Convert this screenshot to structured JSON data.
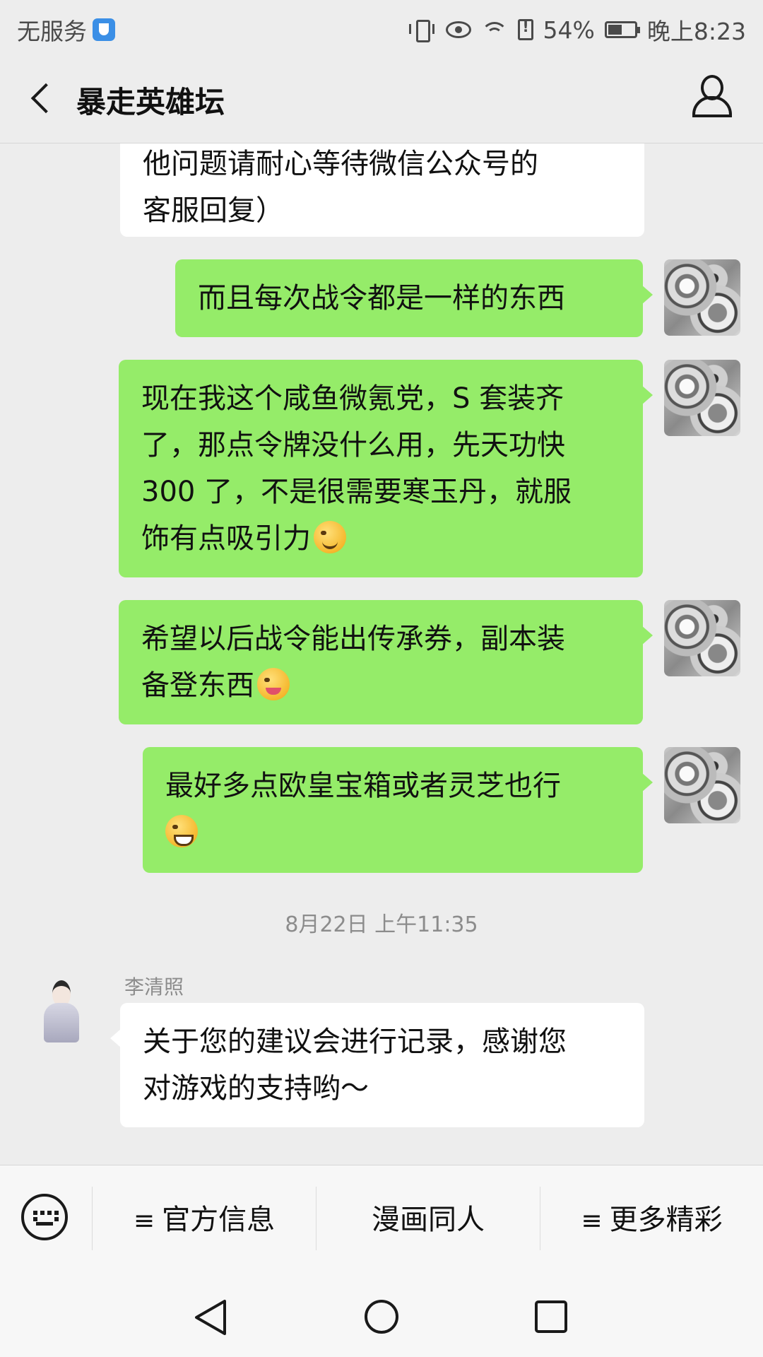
{
  "status_bar": {
    "carrier": "无服务",
    "battery_percent": "54%",
    "time": "晚上8:23",
    "battery_level": 0.54
  },
  "header": {
    "title": "暴走英雄坛"
  },
  "messages": {
    "m0": {
      "line1": "他问题请耐心等待微信公众号的",
      "line2": "客服回复）"
    },
    "m1": {
      "text": "而且每次战令都是一样的东西"
    },
    "m2": {
      "line1": "现在我这个咸鱼微氪党，S 套装齐",
      "line2": "了，那点令牌没什么用，先天功快",
      "line3": "300 了，不是很需要寒玉丹，就服",
      "line4": "饰有点吸引力"
    },
    "m3": {
      "line1": "希望以后战令能出传承券，副本装",
      "line2": "备登东西"
    },
    "m4": {
      "line1": "最好多点欧皇宝箱或者灵芝也行"
    },
    "timestamp": "8月22日 上午11:35",
    "reply": {
      "sender": "李清照",
      "line1": "关于您的建议会进行记录，感谢您",
      "line2": "对游戏的支持哟～"
    }
  },
  "menu": {
    "items": [
      {
        "label": "官方信息",
        "prefix": "≡"
      },
      {
        "label": "漫画同人"
      },
      {
        "label": "更多精彩",
        "prefix": "≡"
      }
    ]
  }
}
